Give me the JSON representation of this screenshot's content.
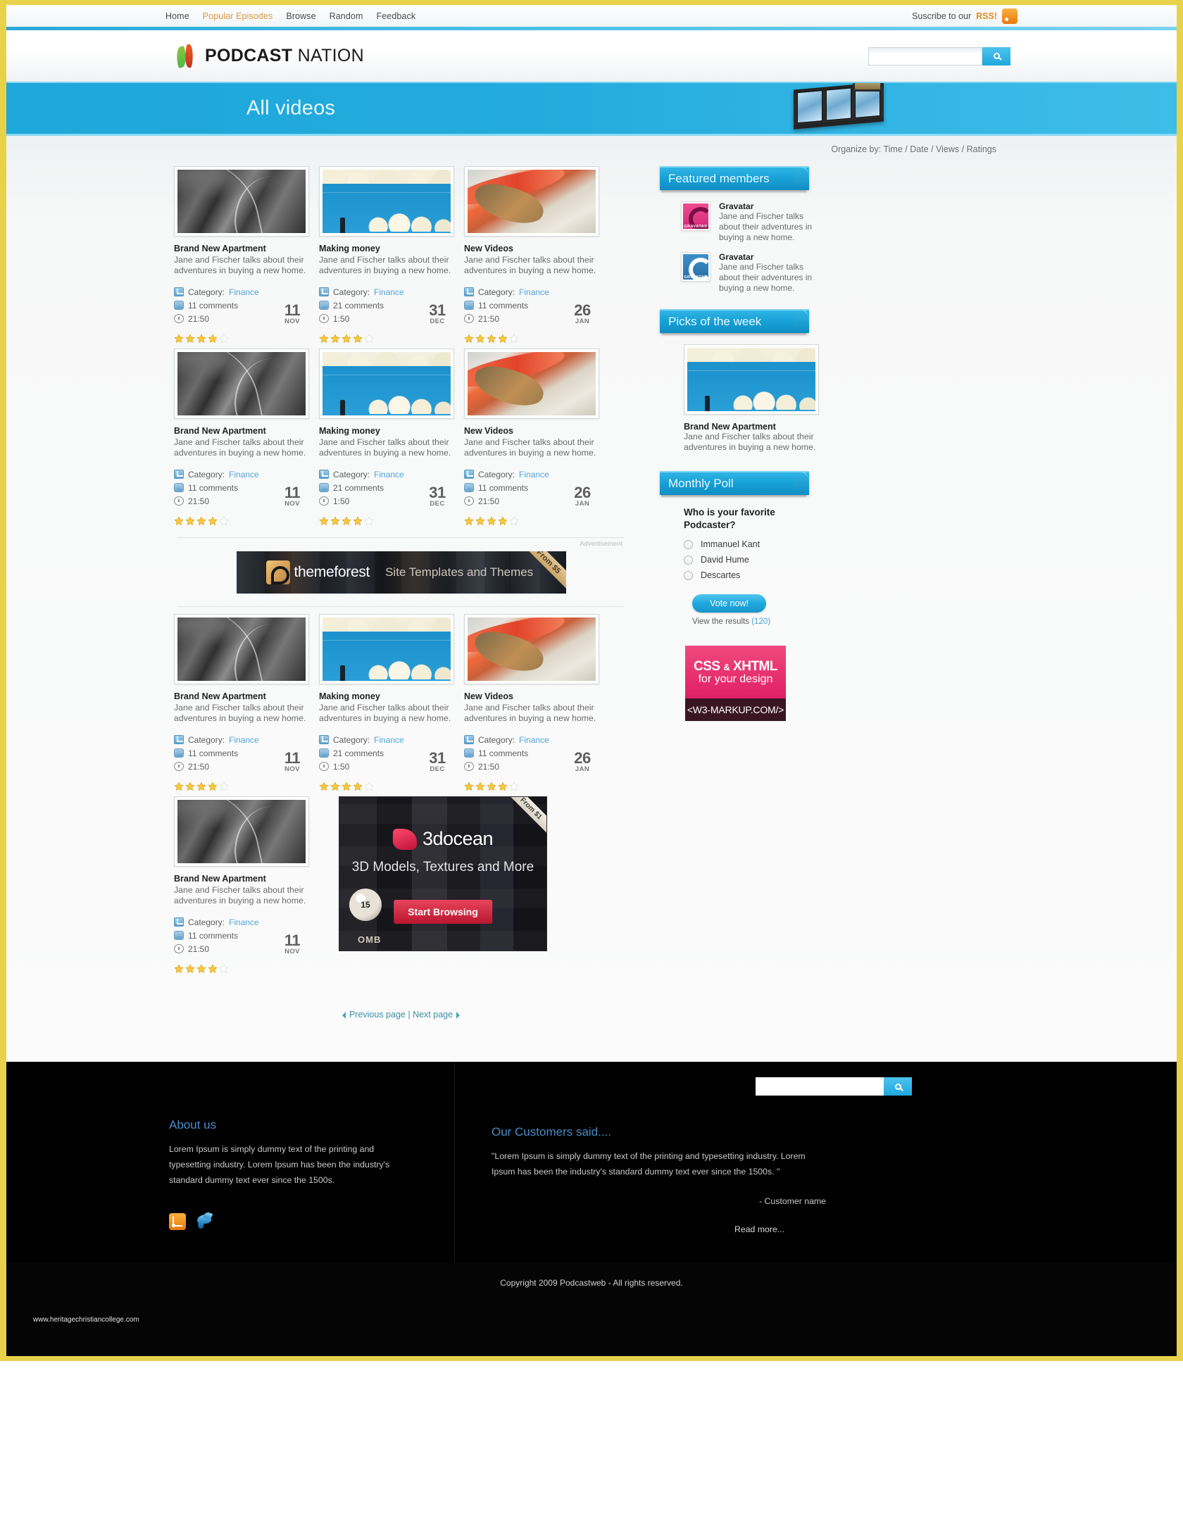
{
  "topnav": {
    "links": [
      {
        "label": "Home",
        "active": false
      },
      {
        "label": "Popular Episodes",
        "active": true
      },
      {
        "label": "Browse",
        "active": false
      },
      {
        "label": "Random",
        "active": false
      },
      {
        "label": "Feedback",
        "active": false
      }
    ],
    "rss_text": "Suscribe to our",
    "rss_label": "RSS!",
    "rss_icon": "rss-icon"
  },
  "header": {
    "logo_bold": "PODCAST",
    "logo_light": " NATION",
    "search_value": "",
    "search_placeholder": "",
    "search_icon": "search-icon"
  },
  "banner": {
    "title": "All videos",
    "image_icon": "film-strip-icon"
  },
  "organize": {
    "prefix": "Organize by:",
    "options": [
      "Time",
      "Date",
      "Views",
      "Ratings"
    ],
    "separator": "/"
  },
  "videos": [
    {
      "title": "Brand New Apartment",
      "desc": "Jane and Fischer talks about their adventures in buying a new home.",
      "category_label": "Category:",
      "category": "Finance",
      "comments": "11 comments",
      "duration": "21:50",
      "day": "11",
      "month": "NOV",
      "rating": 4,
      "thumb": "leaves"
    },
    {
      "title": "Making money",
      "desc": "Jane and Fischer talks about their adventures in buying a new home.",
      "category_label": "Category:",
      "category": "Finance",
      "comments": "21 comments",
      "duration": "1:50",
      "day": "31",
      "month": "DEC",
      "rating": 4,
      "thumb": "sky"
    },
    {
      "title": "New Videos",
      "desc": "Jane and Fischer talks about their adventures in buying a new home.",
      "category_label": "Category:",
      "category": "Finance",
      "comments": "11 comments",
      "duration": "21:50",
      "day": "26",
      "month": "JAN",
      "rating": 4,
      "thumb": "shrimp"
    },
    {
      "title": "Brand New Apartment",
      "desc": "Jane and Fischer talks about their adventures in buying a new home.",
      "category_label": "Category:",
      "category": "Finance",
      "comments": "11 comments",
      "duration": "21:50",
      "day": "11",
      "month": "NOV",
      "rating": 4,
      "thumb": "leaves"
    },
    {
      "title": "Making money",
      "desc": "Jane and Fischer talks about their adventures in buying a new home.",
      "category_label": "Category:",
      "category": "Finance",
      "comments": "21 comments",
      "duration": "1:50",
      "day": "31",
      "month": "DEC",
      "rating": 4,
      "thumb": "sky"
    },
    {
      "title": "New Videos",
      "desc": "Jane and Fischer talks about their adventures in buying a new home.",
      "category_label": "Category:",
      "category": "Finance",
      "comments": "11 comments",
      "duration": "21:50",
      "day": "26",
      "month": "JAN",
      "rating": 4,
      "thumb": "shrimp"
    },
    {
      "title": "Brand New Apartment",
      "desc": "Jane and Fischer talks about their adventures in buying a new home.",
      "category_label": "Category:",
      "category": "Finance",
      "comments": "11 comments",
      "duration": "21:50",
      "day": "11",
      "month": "NOV",
      "rating": 4,
      "thumb": "leaves"
    },
    {
      "title": "Making money",
      "desc": "Jane and Fischer talks about their adventures in buying a new home.",
      "category_label": "Category:",
      "category": "Finance",
      "comments": "21 comments",
      "duration": "1:50",
      "day": "31",
      "month": "DEC",
      "rating": 4,
      "thumb": "sky"
    },
    {
      "title": "New Videos",
      "desc": "Jane and Fischer talks about their adventures in buying a new home.",
      "category_label": "Category:",
      "category": "Finance",
      "comments": "11 comments",
      "duration": "21:50",
      "day": "26",
      "month": "JAN",
      "rating": 4,
      "thumb": "shrimp"
    },
    {
      "title": "Brand New Apartment",
      "desc": "Jane and Fischer talks about their adventures in buying a new home.",
      "category_label": "Category:",
      "category": "Finance",
      "comments": "11 comments",
      "duration": "21:50",
      "day": "11",
      "month": "NOV",
      "rating": 4,
      "thumb": "leaves"
    }
  ],
  "ad_banner": {
    "label": "Advertisement",
    "brand": "themeforest",
    "tagline": "Site Templates and Themes",
    "ribbon": "From $5"
  },
  "ad_square": {
    "brand": "3docean",
    "tagline": "3D Models, Textures and More",
    "button": "Start Browsing",
    "ribbon": "From $1",
    "ball_number": "15",
    "corner_text": "OMB"
  },
  "pager": {
    "prev": "Previous page",
    "sep": "|",
    "next": "Next page"
  },
  "sidebar": {
    "featured": {
      "heading": "Featured members",
      "members": [
        {
          "name": "Gravatar",
          "desc": "Jane and Fischer talks about their adventures in buying a new home.",
          "tag": "GRAVATAR",
          "color": "pink"
        },
        {
          "name": "Gravatar",
          "desc": "Jane and Fischer talks about their adventures in buying a new home.",
          "tag": "GRAVATAR",
          "color": "blue"
        }
      ]
    },
    "picks": {
      "heading": "Picks of the week",
      "title": "Brand New Apartment",
      "desc": "Jane and Fischer talks about their adventures in buying a new home."
    },
    "poll": {
      "heading": "Monthly Poll",
      "question": "Who is your favorite Podcaster?",
      "options": [
        "Immanuel Kant",
        "David Hume",
        "Descartes"
      ],
      "vote_button": "Vote now!",
      "results_text": "View the results",
      "results_count": "(120)"
    },
    "css_ad": {
      "line1a": "CSS",
      "line1b": "&",
      "line1c": "XHTML",
      "line2": "for your design",
      "line3": "<W3-MARKUP.COM/>"
    }
  },
  "footer": {
    "search_value": "",
    "search_icon": "search-icon",
    "about": {
      "heading": "About us",
      "body": "Lorem Ipsum is simply dummy text of the printing and typesetting industry. Lorem Ipsum has been the industry's standard dummy text ever since the 1500s."
    },
    "customers": {
      "heading": "Our Customers said....",
      "body": "\"Lorem Ipsum is simply dummy text of the printing and typesetting industry. Lorem Ipsum has been the industry's standard dummy text ever since the 1500s. \"",
      "attribution": "- Customer name",
      "read_more": "Read more..."
    },
    "social": [
      "rss-icon",
      "twitter-icon"
    ],
    "copyright": "Copyright 2009 Podcastweb - All rights reserved.",
    "watermark": "www.heritagechristiancollege.com"
  },
  "colors": {
    "accent_blue": "#1ea7da",
    "border_yellow": "#e8d24a",
    "link_blue": "#51a6d6",
    "star_gold": "#f5c026"
  }
}
